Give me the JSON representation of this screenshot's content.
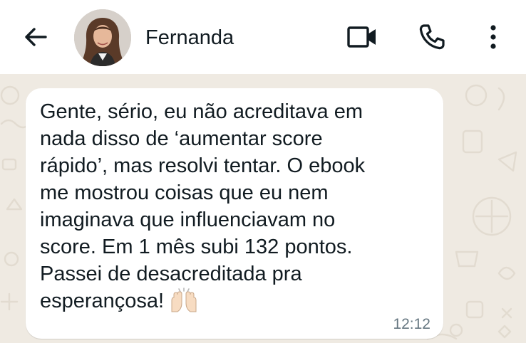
{
  "header": {
    "contact_name": "Fernanda",
    "icons": {
      "back": "arrow-back-icon",
      "video": "video-camera-icon",
      "call": "phone-icon",
      "menu": "more-vertical-icon"
    }
  },
  "message": {
    "text": "Gente, sério, eu não acreditava em\nnada disso de ‘aumentar score\nrápido’, mas resolvi tentar. O ebook\nme mostrou coisas que eu nem\nimaginava que influenciavam no\nscore. Em 1 mês subi 132 pontos.\nPassei de desacreditada pra\nesperançosa!",
    "emoji": "raising-hands-emoji",
    "time": "12:12"
  },
  "colors": {
    "header_bg": "#ffffff",
    "chat_bg": "#efeae2",
    "bubble_bg": "#ffffff",
    "text": "#111b21",
    "timestamp": "#667781"
  }
}
